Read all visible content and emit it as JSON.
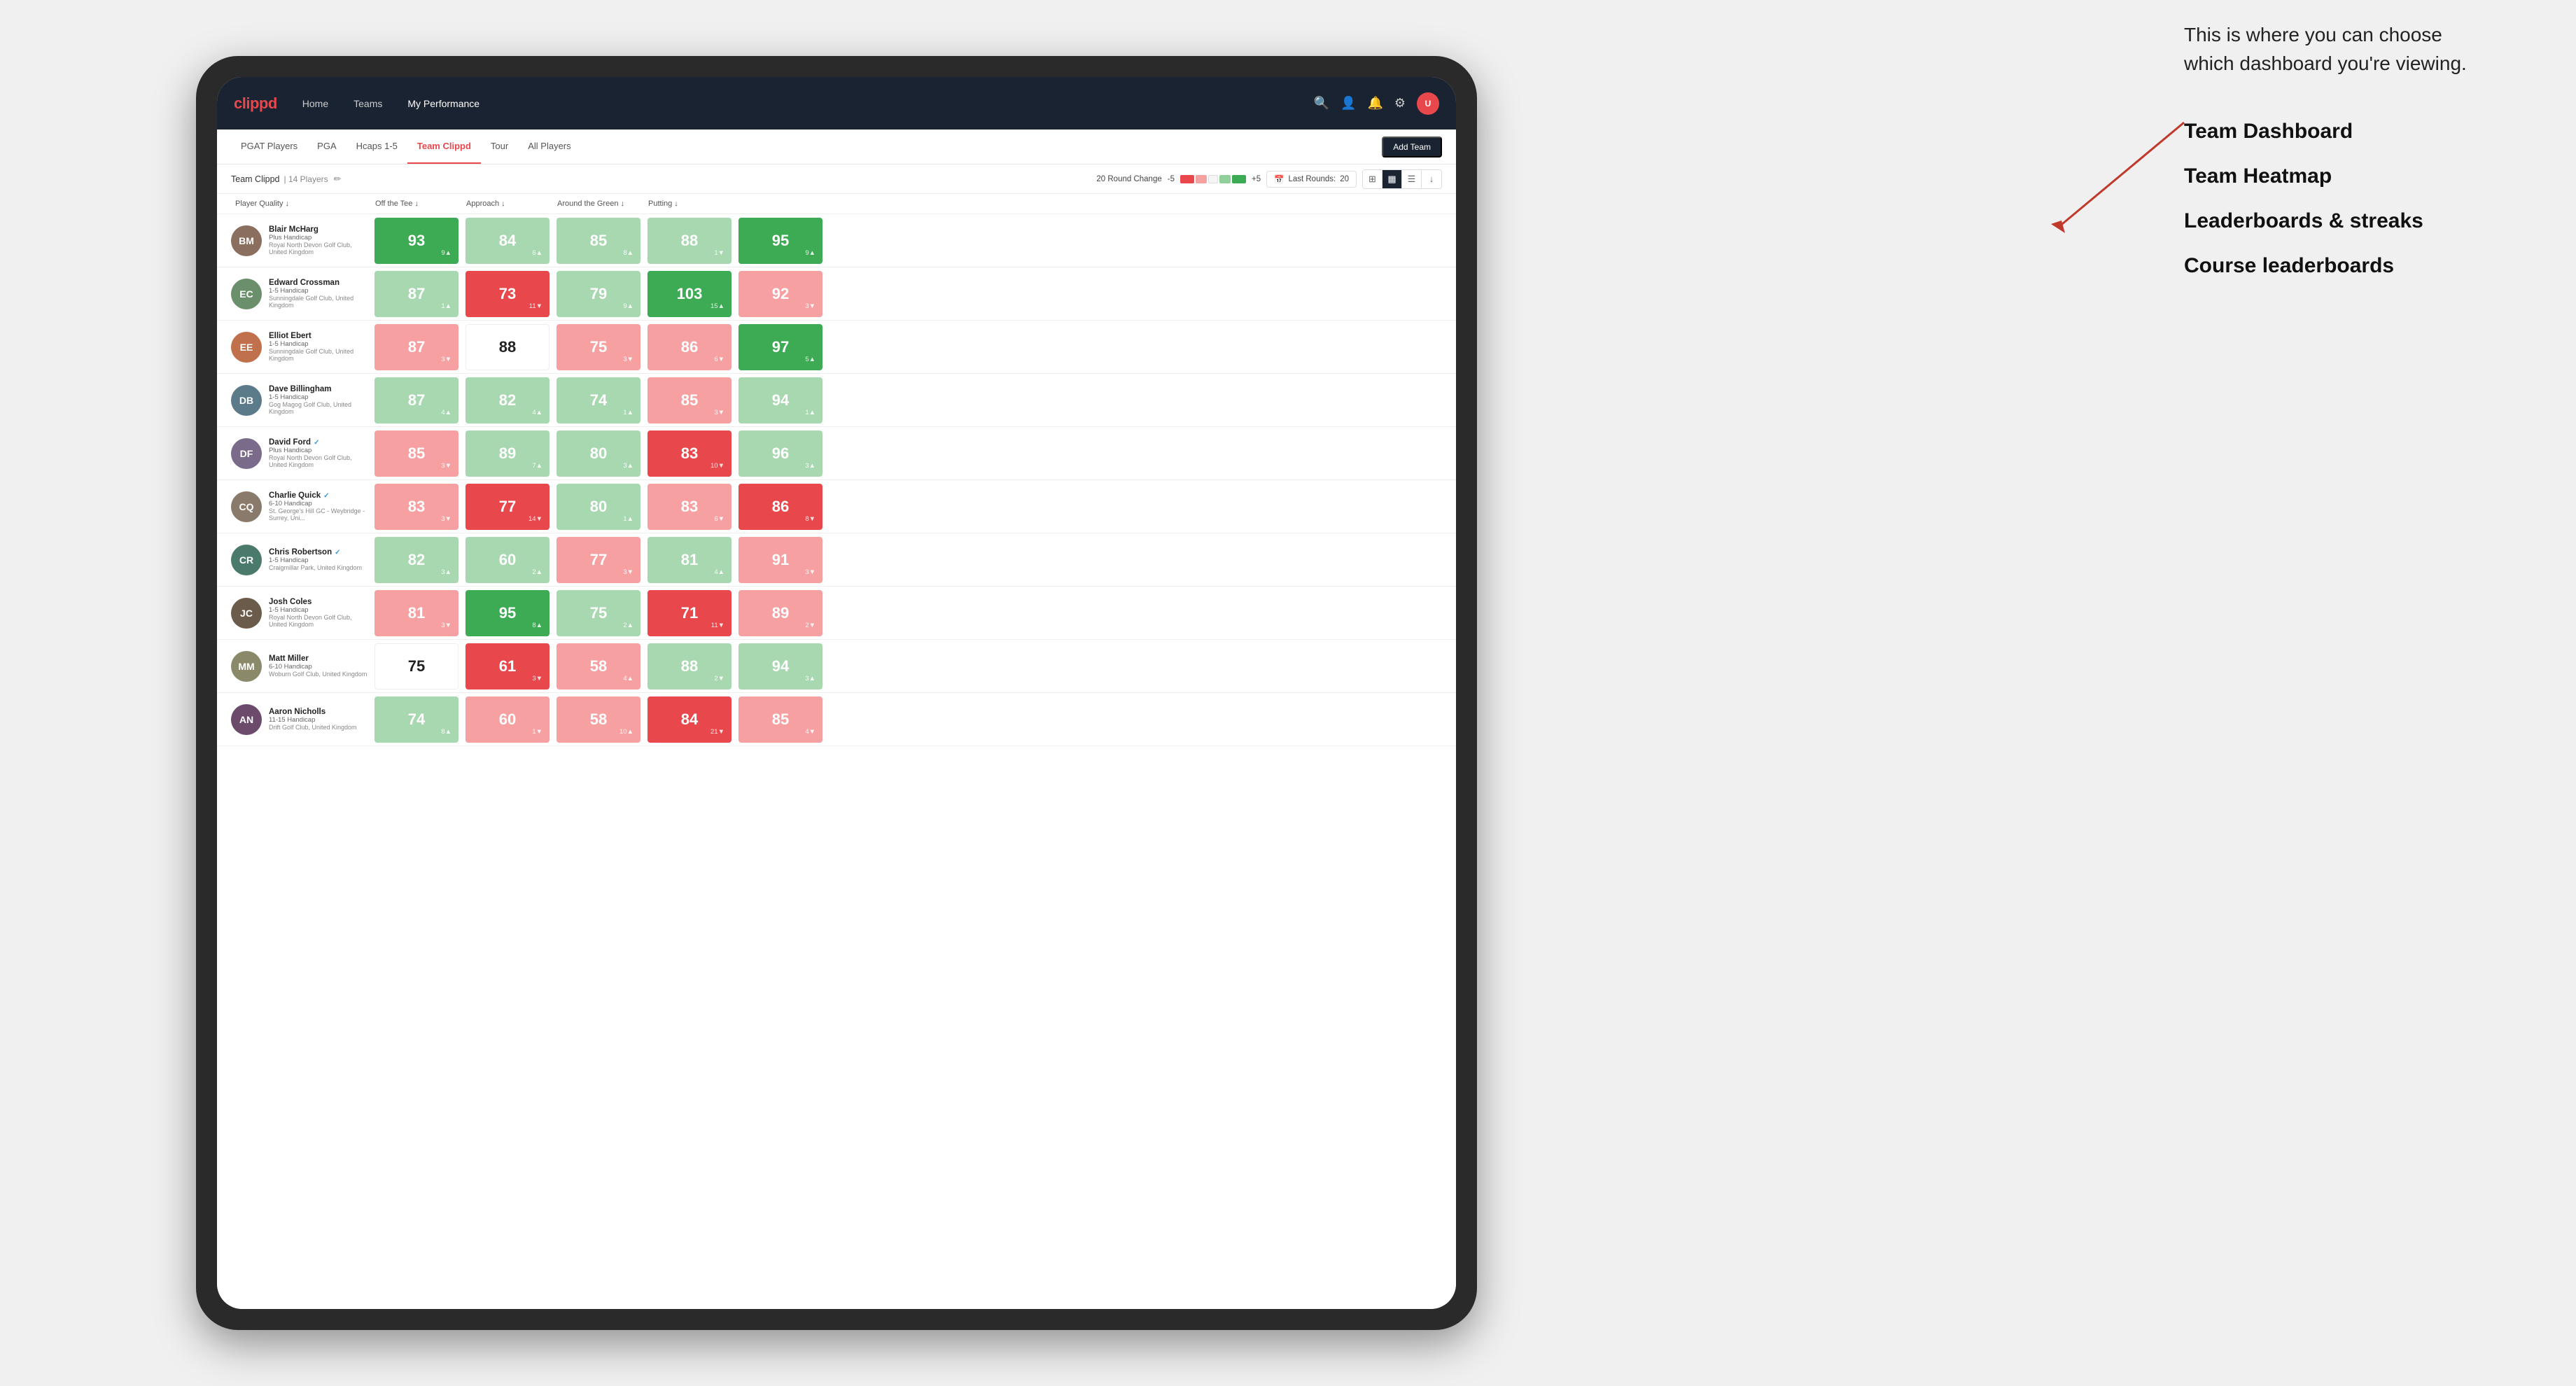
{
  "annotation": {
    "text": "This is where you can choose which dashboard you're viewing.",
    "menu_items": [
      "Team Dashboard",
      "Team Heatmap",
      "Leaderboards & streaks",
      "Course leaderboards"
    ]
  },
  "nav": {
    "logo": "clippd",
    "links": [
      "Home",
      "Teams",
      "My Performance"
    ],
    "active_link": "My Performance"
  },
  "sub_tabs": {
    "tabs": [
      "PGAT Players",
      "PGA",
      "Hcaps 1-5",
      "Team Clippd",
      "Tour",
      "All Players"
    ],
    "active": "Team Clippd",
    "add_team_label": "Add Team"
  },
  "team_bar": {
    "name": "Team Clippd",
    "count": "14 Players",
    "round_change_label": "20 Round Change",
    "low": "-5",
    "high": "+5",
    "last_rounds_label": "Last Rounds:",
    "last_rounds_value": "20"
  },
  "table": {
    "columns": [
      "Player Quality ↓",
      "Off the Tee ↓",
      "Approach ↓",
      "Around the Green ↓",
      "Putting ↓"
    ],
    "players": [
      {
        "name": "Blair McHarg",
        "handicap": "Plus Handicap",
        "club": "Royal North Devon Golf Club, United Kingdom",
        "avatar_color": "#8B6F5E",
        "initials": "BM",
        "scores": [
          {
            "value": 93,
            "change": "+9",
            "dir": "up",
            "color": "green-dark"
          },
          {
            "value": 84,
            "change": "+6",
            "dir": "up",
            "color": "green-light"
          },
          {
            "value": 85,
            "change": "+8",
            "dir": "up",
            "color": "green-light"
          },
          {
            "value": 88,
            "change": "-1",
            "dir": "down",
            "color": "green-light"
          },
          {
            "value": 95,
            "change": "+9",
            "dir": "up",
            "color": "green-dark"
          }
        ]
      },
      {
        "name": "Edward Crossman",
        "handicap": "1-5 Handicap",
        "club": "Sunningdale Golf Club, United Kingdom",
        "avatar_color": "#6B8E6B",
        "initials": "EC",
        "scores": [
          {
            "value": 87,
            "change": "+1",
            "dir": "up",
            "color": "green-light"
          },
          {
            "value": 73,
            "change": "-11",
            "dir": "down",
            "color": "red-dark"
          },
          {
            "value": 79,
            "change": "+9",
            "dir": "up",
            "color": "green-light"
          },
          {
            "value": 103,
            "change": "+15",
            "dir": "up",
            "color": "green-dark"
          },
          {
            "value": 92,
            "change": "-3",
            "dir": "down",
            "color": "red-light"
          }
        ]
      },
      {
        "name": "Elliot Ebert",
        "handicap": "1-5 Handicap",
        "club": "Sunningdale Golf Club, United Kingdom",
        "avatar_color": "#C0704A",
        "initials": "EE",
        "scores": [
          {
            "value": 87,
            "change": "-3",
            "dir": "down",
            "color": "red-light"
          },
          {
            "value": 88,
            "change": "",
            "dir": "",
            "color": "white"
          },
          {
            "value": 75,
            "change": "-3",
            "dir": "down",
            "color": "red-light"
          },
          {
            "value": 86,
            "change": "-6",
            "dir": "down",
            "color": "red-light"
          },
          {
            "value": 97,
            "change": "+5",
            "dir": "up",
            "color": "green-dark"
          }
        ]
      },
      {
        "name": "Dave Billingham",
        "handicap": "1-5 Handicap",
        "club": "Gog Magog Golf Club, United Kingdom",
        "avatar_color": "#5B7A8A",
        "initials": "DB",
        "scores": [
          {
            "value": 87,
            "change": "+4",
            "dir": "up",
            "color": "green-light"
          },
          {
            "value": 82,
            "change": "+4",
            "dir": "up",
            "color": "green-light"
          },
          {
            "value": 74,
            "change": "+1",
            "dir": "up",
            "color": "green-light"
          },
          {
            "value": 85,
            "change": "-3",
            "dir": "down",
            "color": "red-light"
          },
          {
            "value": 94,
            "change": "+1",
            "dir": "up",
            "color": "green-light"
          }
        ]
      },
      {
        "name": "David Ford",
        "handicap": "Plus Handicap",
        "club": "Royal North Devon Golf Club, United Kingdom",
        "avatar_color": "#7A6B8A",
        "initials": "DF",
        "verified": true,
        "scores": [
          {
            "value": 85,
            "change": "-3",
            "dir": "down",
            "color": "red-light"
          },
          {
            "value": 89,
            "change": "+7",
            "dir": "up",
            "color": "green-light"
          },
          {
            "value": 80,
            "change": "+3",
            "dir": "up",
            "color": "green-light"
          },
          {
            "value": 83,
            "change": "-10",
            "dir": "down",
            "color": "red-dark"
          },
          {
            "value": 96,
            "change": "+3",
            "dir": "up",
            "color": "green-light"
          }
        ]
      },
      {
        "name": "Charlie Quick",
        "handicap": "6-10 Handicap",
        "club": "St. George's Hill GC - Weybridge - Surrey, Uni...",
        "avatar_color": "#8A7A6B",
        "initials": "CQ",
        "verified": true,
        "scores": [
          {
            "value": 83,
            "change": "-3",
            "dir": "down",
            "color": "red-light"
          },
          {
            "value": 77,
            "change": "-14",
            "dir": "down",
            "color": "red-dark"
          },
          {
            "value": 80,
            "change": "+1",
            "dir": "up",
            "color": "green-light"
          },
          {
            "value": 83,
            "change": "-6",
            "dir": "down",
            "color": "red-light"
          },
          {
            "value": 86,
            "change": "-8",
            "dir": "down",
            "color": "red-dark"
          }
        ]
      },
      {
        "name": "Chris Robertson",
        "handicap": "1-5 Handicap",
        "club": "Craigmillar Park, United Kingdom",
        "avatar_color": "#4A7A6B",
        "initials": "CR",
        "verified": true,
        "scores": [
          {
            "value": 82,
            "change": "+3",
            "dir": "up",
            "color": "green-light"
          },
          {
            "value": 60,
            "change": "+2",
            "dir": "up",
            "color": "green-light"
          },
          {
            "value": 77,
            "change": "-3",
            "dir": "down",
            "color": "red-light"
          },
          {
            "value": 81,
            "change": "+4",
            "dir": "up",
            "color": "green-light"
          },
          {
            "value": 91,
            "change": "-3",
            "dir": "down",
            "color": "red-light"
          }
        ]
      },
      {
        "name": "Josh Coles",
        "handicap": "1-5 Handicap",
        "club": "Royal North Devon Golf Club, United Kingdom",
        "avatar_color": "#6B5B4A",
        "initials": "JC",
        "scores": [
          {
            "value": 81,
            "change": "-3",
            "dir": "down",
            "color": "red-light"
          },
          {
            "value": 95,
            "change": "+8",
            "dir": "up",
            "color": "green-dark"
          },
          {
            "value": 75,
            "change": "+2",
            "dir": "up",
            "color": "green-light"
          },
          {
            "value": 71,
            "change": "-11",
            "dir": "down",
            "color": "red-dark"
          },
          {
            "value": 89,
            "change": "-2",
            "dir": "down",
            "color": "red-light"
          }
        ]
      },
      {
        "name": "Matt Miller",
        "handicap": "6-10 Handicap",
        "club": "Woburn Golf Club, United Kingdom",
        "avatar_color": "#8A8A6B",
        "initials": "MM",
        "scores": [
          {
            "value": 75,
            "change": "",
            "dir": "",
            "color": "white"
          },
          {
            "value": 61,
            "change": "-3",
            "dir": "down",
            "color": "red-dark"
          },
          {
            "value": 58,
            "change": "+4",
            "dir": "up",
            "color": "red-light"
          },
          {
            "value": 88,
            "change": "-2",
            "dir": "down",
            "color": "green-light"
          },
          {
            "value": 94,
            "change": "+3",
            "dir": "up",
            "color": "green-light"
          }
        ]
      },
      {
        "name": "Aaron Nicholls",
        "handicap": "11-15 Handicap",
        "club": "Drift Golf Club, United Kingdom",
        "avatar_color": "#6B4A6B",
        "initials": "AN",
        "scores": [
          {
            "value": 74,
            "change": "+8",
            "dir": "up",
            "color": "green-light"
          },
          {
            "value": 60,
            "change": "-1",
            "dir": "down",
            "color": "red-light"
          },
          {
            "value": 58,
            "change": "+10",
            "dir": "up",
            "color": "red-light"
          },
          {
            "value": 84,
            "change": "-21",
            "dir": "down",
            "color": "red-dark"
          },
          {
            "value": 85,
            "change": "-4",
            "dir": "down",
            "color": "red-light"
          }
        ]
      }
    ]
  }
}
